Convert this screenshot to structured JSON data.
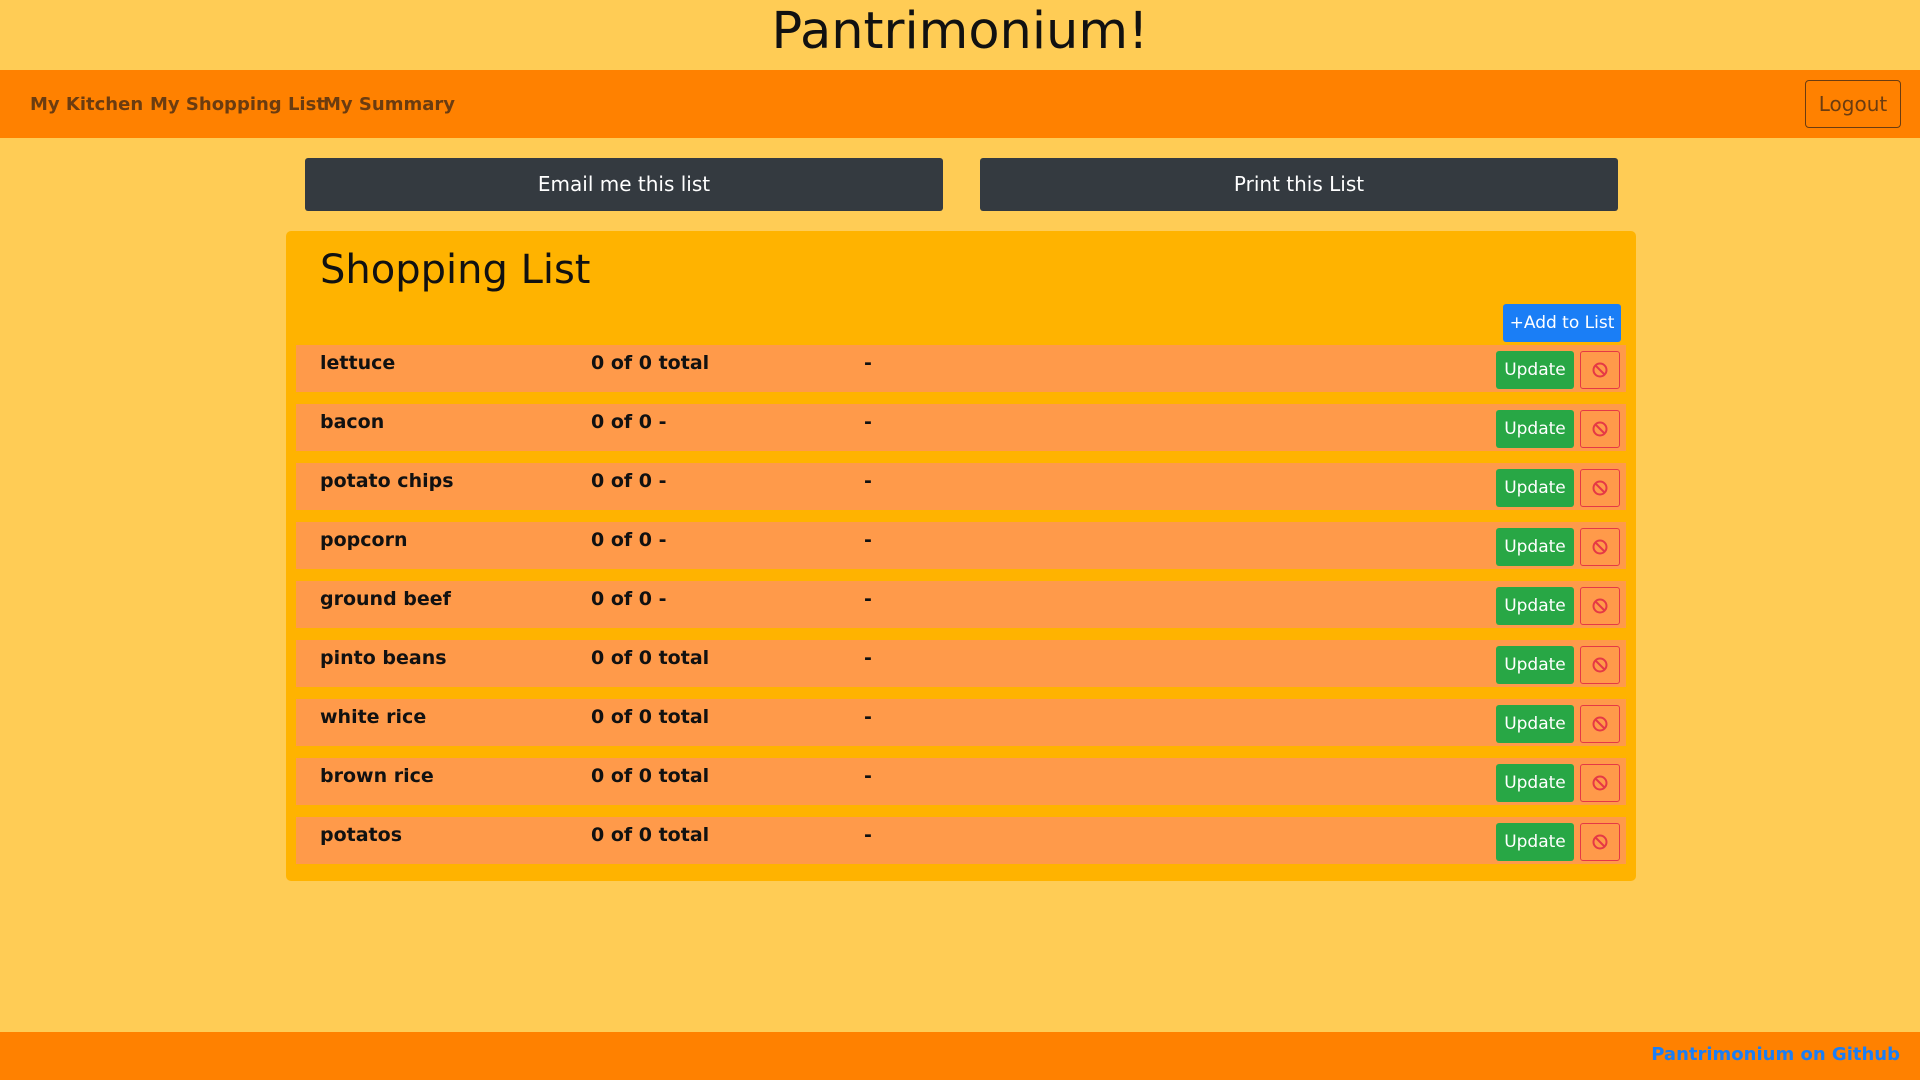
{
  "app": {
    "title": "Pantrimonium!"
  },
  "nav": {
    "links": [
      "My Kitchen",
      "My Shopping List",
      "My Summary"
    ],
    "logout_label": "Logout"
  },
  "actions": {
    "email_label": "Email me this list",
    "print_label": "Print this List"
  },
  "panel": {
    "title": "Shopping List",
    "add_label": "+Add to List"
  },
  "items": [
    {
      "name": "lettuce",
      "qty": "0 of 0 total",
      "extra": "-"
    },
    {
      "name": "bacon",
      "qty": "0 of 0 -",
      "extra": "-"
    },
    {
      "name": "potato chips",
      "qty": "0 of 0 -",
      "extra": "-"
    },
    {
      "name": "popcorn",
      "qty": "0 of 0 -",
      "extra": "-"
    },
    {
      "name": "ground beef",
      "qty": "0 of 0 -",
      "extra": "-"
    },
    {
      "name": "pinto beans",
      "qty": "0 of 0 total",
      "extra": "-"
    },
    {
      "name": "white rice",
      "qty": "0 of 0 total",
      "extra": "-"
    },
    {
      "name": "brown rice",
      "qty": "0 of 0 total",
      "extra": "-"
    },
    {
      "name": "potatos",
      "qty": "0 of 0 total",
      "extra": "-"
    }
  ],
  "row_actions": {
    "update_label": "Update",
    "remove_icon": "ban-icon"
  },
  "footer": {
    "link_text": "Pantrimonium on Github"
  },
  "colors": {
    "background": "#ffcc55",
    "navbar": "#ff8100",
    "panel": "#ffb300",
    "row": "#ff9a4a",
    "dark_button": "#343a40",
    "primary": "#1a7ef6",
    "success": "#28a745",
    "danger": "#e53945"
  }
}
